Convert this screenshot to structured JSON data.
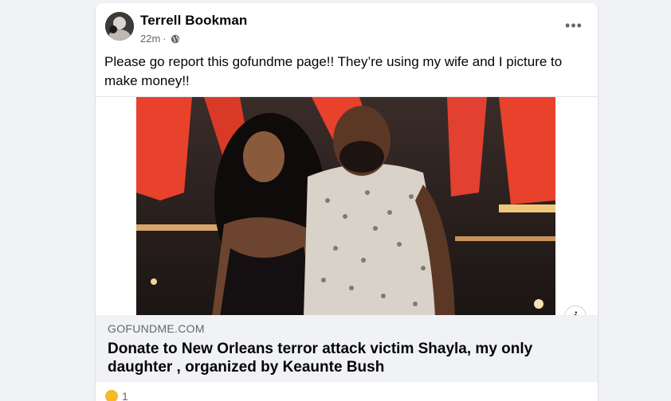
{
  "post": {
    "author": "Terrell Bookman",
    "timestamp": "22m",
    "separator": "·",
    "privacy_icon": "globe-icon",
    "more_icon": "•••",
    "text": "Please go report this gofundme page!! They’re using my wife and I picture to make money!!"
  },
  "link_preview": {
    "domain": "GOFUNDME.COM",
    "title": "Donate to New Orleans terror attack victim Shayla, my only daughter , organized by Keaunte Bush",
    "info_icon": "i"
  },
  "reactions": {
    "icon": "emoji-reaction-icon",
    "count": "1"
  },
  "colors": {
    "page_bg": "#f0f2f5",
    "card_bg": "#ffffff",
    "secondary_text": "#65676b",
    "neon_sign": "#e8412c"
  }
}
